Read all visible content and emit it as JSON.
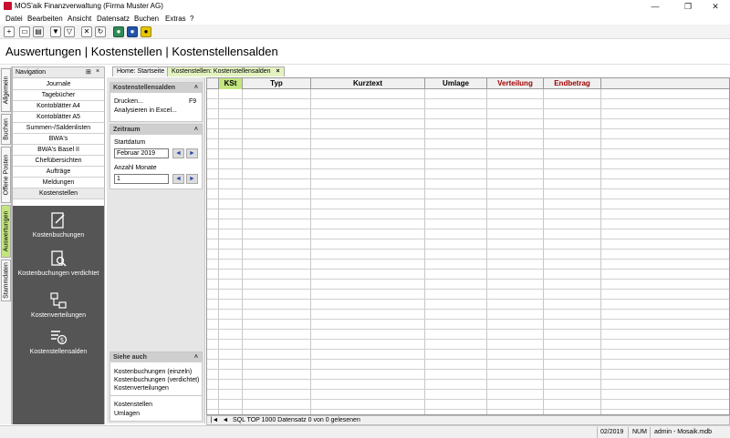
{
  "window": {
    "title": "MOS'aik Finanzverwaltung (Firma Muster AG)",
    "minimize": "—",
    "maximize": "❐",
    "close": "✕"
  },
  "menu": [
    "Datei",
    "Bearbeiten",
    "Ansicht",
    "Datensatz",
    "Buchen",
    "Extras",
    "?"
  ],
  "heading": "Auswertungen | Kostenstellen | Kostenstellensalden",
  "vtabs": [
    "Allgemein",
    "Buchen",
    "Offene Posten",
    "Auswertungen",
    "Stammdaten"
  ],
  "nav": {
    "title": "Navigation",
    "pin": "⊞",
    "close": "×",
    "items": [
      "Journale",
      "Tagebücher",
      "Kontoblätter A4",
      "Kontoblätter A5",
      "Summen-/Saldenlisten",
      "BWA's",
      "BWA's Basel II",
      "Chefübersichten",
      "Aufträge",
      "Meldungen",
      "Kostenstellen"
    ],
    "big_items": [
      "Kostenbuchungen",
      "Kostenbuchungen verdichtet",
      "Kostenverteilungen",
      "Kostenstellensalden"
    ]
  },
  "doc_tabs": {
    "home": "Home: Startseite",
    "active": "Kostenstellen: Kostenstellensalden",
    "close": "×"
  },
  "taskpane": {
    "section1": {
      "title": "Kostenstellensalden",
      "collapse": "˄",
      "print": "Drucken...",
      "print_key": "F9",
      "analyze": "Analysieren in Excel..."
    },
    "section2": {
      "title": "Zeitraum",
      "collapse": "˄",
      "start_label": "Startdatum",
      "start_value": "Februar 2019",
      "months_label": "Anzahl Monate",
      "months_value": "1",
      "prev": "◄",
      "next": "►"
    },
    "section3": {
      "title": "Siehe auch",
      "collapse": "˄",
      "links1": [
        "Kostenbuchungen (einzeln)",
        "Kostenbuchungen (verdichtet)",
        "Kostenverteilungen"
      ],
      "links2": [
        "Kostenstellen",
        "Umlagen"
      ]
    }
  },
  "grid": {
    "columns": [
      "KSt",
      "Typ",
      "Kurztext",
      "Umlage",
      "Verteilung",
      "Endbetrag"
    ],
    "colors": {
      "selected": "#c3e57f",
      "red_header": "#a00000"
    }
  },
  "recordnav": {
    "first": "|◄",
    "prev": "◄",
    "text": "SQL TOP 1000 Datensatz 0 von 0 gelesenen"
  },
  "status": {
    "period": "02/2019",
    "num": "NUM",
    "user": "admin - Mosaik.mdb"
  }
}
